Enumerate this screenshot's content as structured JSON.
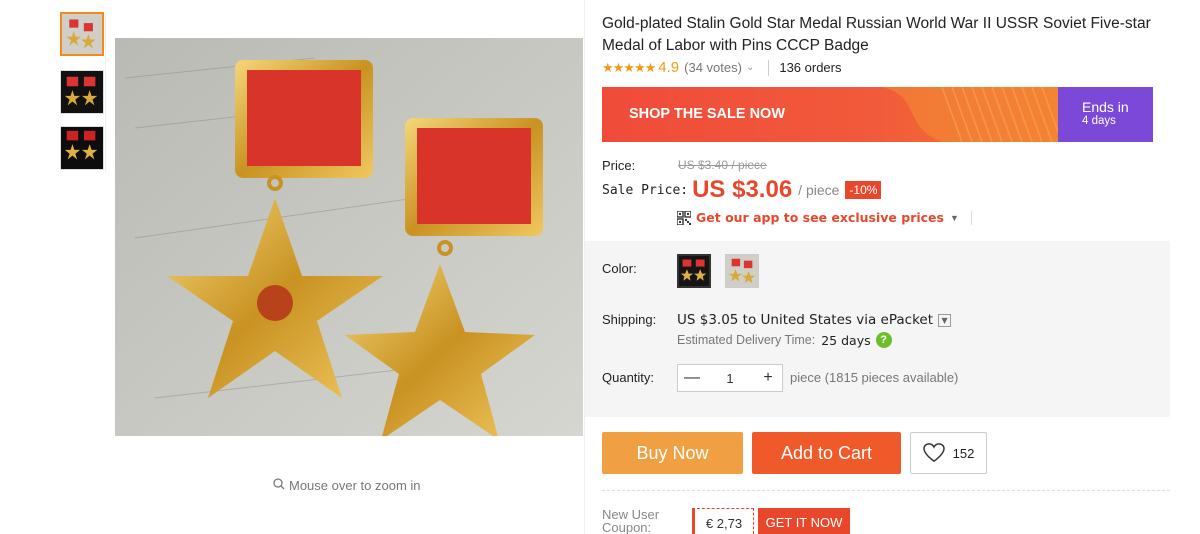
{
  "gallery": {
    "thumbnails": [
      "thumb-1",
      "thumb-2",
      "thumb-3"
    ],
    "zoom_hint": "Mouse over to zoom in"
  },
  "product": {
    "title": "Gold-plated Stalin Gold Star Medal Russian World War II USSR Soviet Five-star Medal of Labor with Pins CCCP Badge",
    "stars": "★★★★★",
    "rating": "4.9",
    "votes": "(34 votes)",
    "orders": "136 orders"
  },
  "banner": {
    "text": "SHOP THE SALE NOW",
    "ends_label": "Ends in",
    "ends_value": "4 days",
    "colors": {
      "left": "#f04b3a",
      "right": "#7c48d8"
    }
  },
  "pricing": {
    "price_label": "Price:",
    "old_price": "US $3.40 / piece",
    "sale_label": "Sale Price:",
    "sale_price": "US $3.06",
    "per_piece": "/ piece",
    "discount": "-10%",
    "app_promo": "Get our app to see exclusive prices",
    "accent_color": "#e8472b"
  },
  "options": {
    "color_label": "Color:",
    "swatches": [
      "color-option-1",
      "color-option-2"
    ],
    "shipping_label": "Shipping:",
    "shipping_value": "US $3.05 to United States via ePacket",
    "delivery_label": "Estimated Delivery Time:",
    "delivery_value": "25 days",
    "help_icon": "?",
    "quantity_label": "Quantity:",
    "qty_minus": "—",
    "qty_value": "1",
    "qty_plus": "+",
    "availability": "piece (1815 pieces available)"
  },
  "actions": {
    "buy_now": "Buy Now",
    "add_to_cart": "Add to Cart",
    "wishlist_count": "152"
  },
  "coupon": {
    "label_line1": "New User",
    "label_line2": "Coupon:",
    "amount": "€ 2,73",
    "get": "GET IT NOW"
  }
}
